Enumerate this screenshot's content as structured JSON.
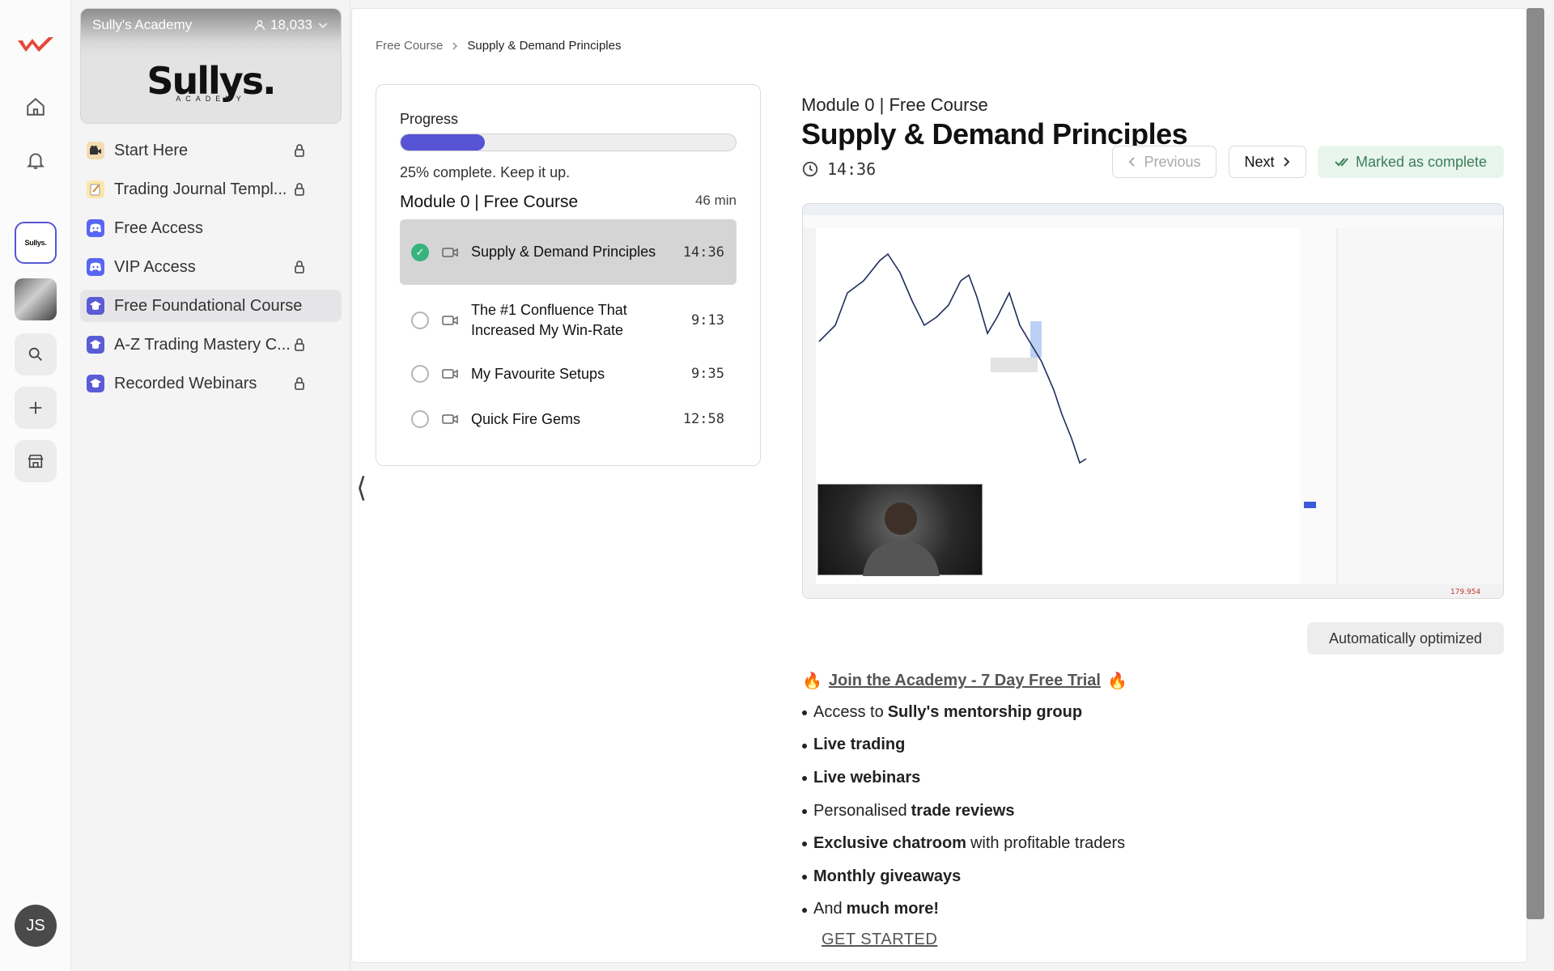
{
  "colors": {
    "accent": "#5653d4",
    "complete_green": "#37b37e",
    "complete_badge_bg": "#e8f5ed",
    "discord_blue": "#5865f2",
    "brand_red": "#e5483b"
  },
  "rail": {
    "icons": [
      "brand-logo-icon",
      "home-icon",
      "bell-icon",
      "search-icon",
      "plus-icon",
      "store-icon"
    ],
    "active_community_label": "Sullys.",
    "avatar_initials": "JS"
  },
  "community": {
    "name": "Sully's Academy",
    "member_count": "18,033",
    "logo_text": "Sullys.",
    "logo_sub": "ACADEMY"
  },
  "sidebar": {
    "items": [
      {
        "label": "Start Here",
        "icon": "camera-icon",
        "locked": true
      },
      {
        "label": "Trading Journal Templ...",
        "icon": "notepad-icon",
        "locked": true
      },
      {
        "label": "Free Access",
        "icon": "discord-icon",
        "locked": false
      },
      {
        "label": "VIP Access",
        "icon": "discord-icon",
        "locked": true
      },
      {
        "label": "Free Foundational Course",
        "icon": "course-icon",
        "locked": false,
        "selected": true
      },
      {
        "label": "A-Z Trading Mastery C...",
        "icon": "course-icon",
        "locked": true
      },
      {
        "label": "Recorded Webinars",
        "icon": "course-icon",
        "locked": true
      }
    ]
  },
  "breadcrumb": {
    "parent": "Free Course",
    "current": "Supply & Demand Principles"
  },
  "progress": {
    "label": "Progress",
    "fraction": 0.25,
    "text": "25% complete. Keep it up."
  },
  "module": {
    "title": "Module 0 | Free Course",
    "duration": "46 min",
    "lessons": [
      {
        "title": "Supply & Demand Principles",
        "time": "14:36",
        "current": true,
        "complete": true
      },
      {
        "title": "The #1 Confluence That Increased My Win-Rate",
        "time": "9:13",
        "current": false,
        "complete": false
      },
      {
        "title": "My Favourite Setups",
        "time": "9:35",
        "current": false,
        "complete": false
      },
      {
        "title": "Quick Fire Gems",
        "time": "12:58",
        "current": false,
        "complete": false
      }
    ]
  },
  "content": {
    "module_label": "Module 0 | Free Course",
    "title": "Supply & Demand Principles",
    "duration": "14:36",
    "previous_label": "Previous",
    "next_label": "Next",
    "complete_label": "Marked as complete",
    "auto_label": "Automatically optimized",
    "price_label": "179.954"
  },
  "promo": {
    "cta_emoji": "🔥",
    "cta_text": "Join the Academy - 7 Day Free Trial",
    "bullets": [
      {
        "pre": "Access to",
        "bold": "Sully's mentorship group",
        "post": ""
      },
      {
        "pre": "",
        "bold": "Live trading",
        "post": ""
      },
      {
        "pre": "",
        "bold": "Live webinars",
        "post": ""
      },
      {
        "pre": "Personalised",
        "bold": "trade reviews",
        "post": ""
      },
      {
        "pre": "",
        "bold": "Exclusive chatroom",
        "post": "with profitable traders"
      },
      {
        "pre": "",
        "bold": "Monthly giveaways",
        "post": ""
      },
      {
        "pre": "And",
        "bold": "much more!",
        "post": ""
      }
    ],
    "get_started": "GET STARTED"
  }
}
